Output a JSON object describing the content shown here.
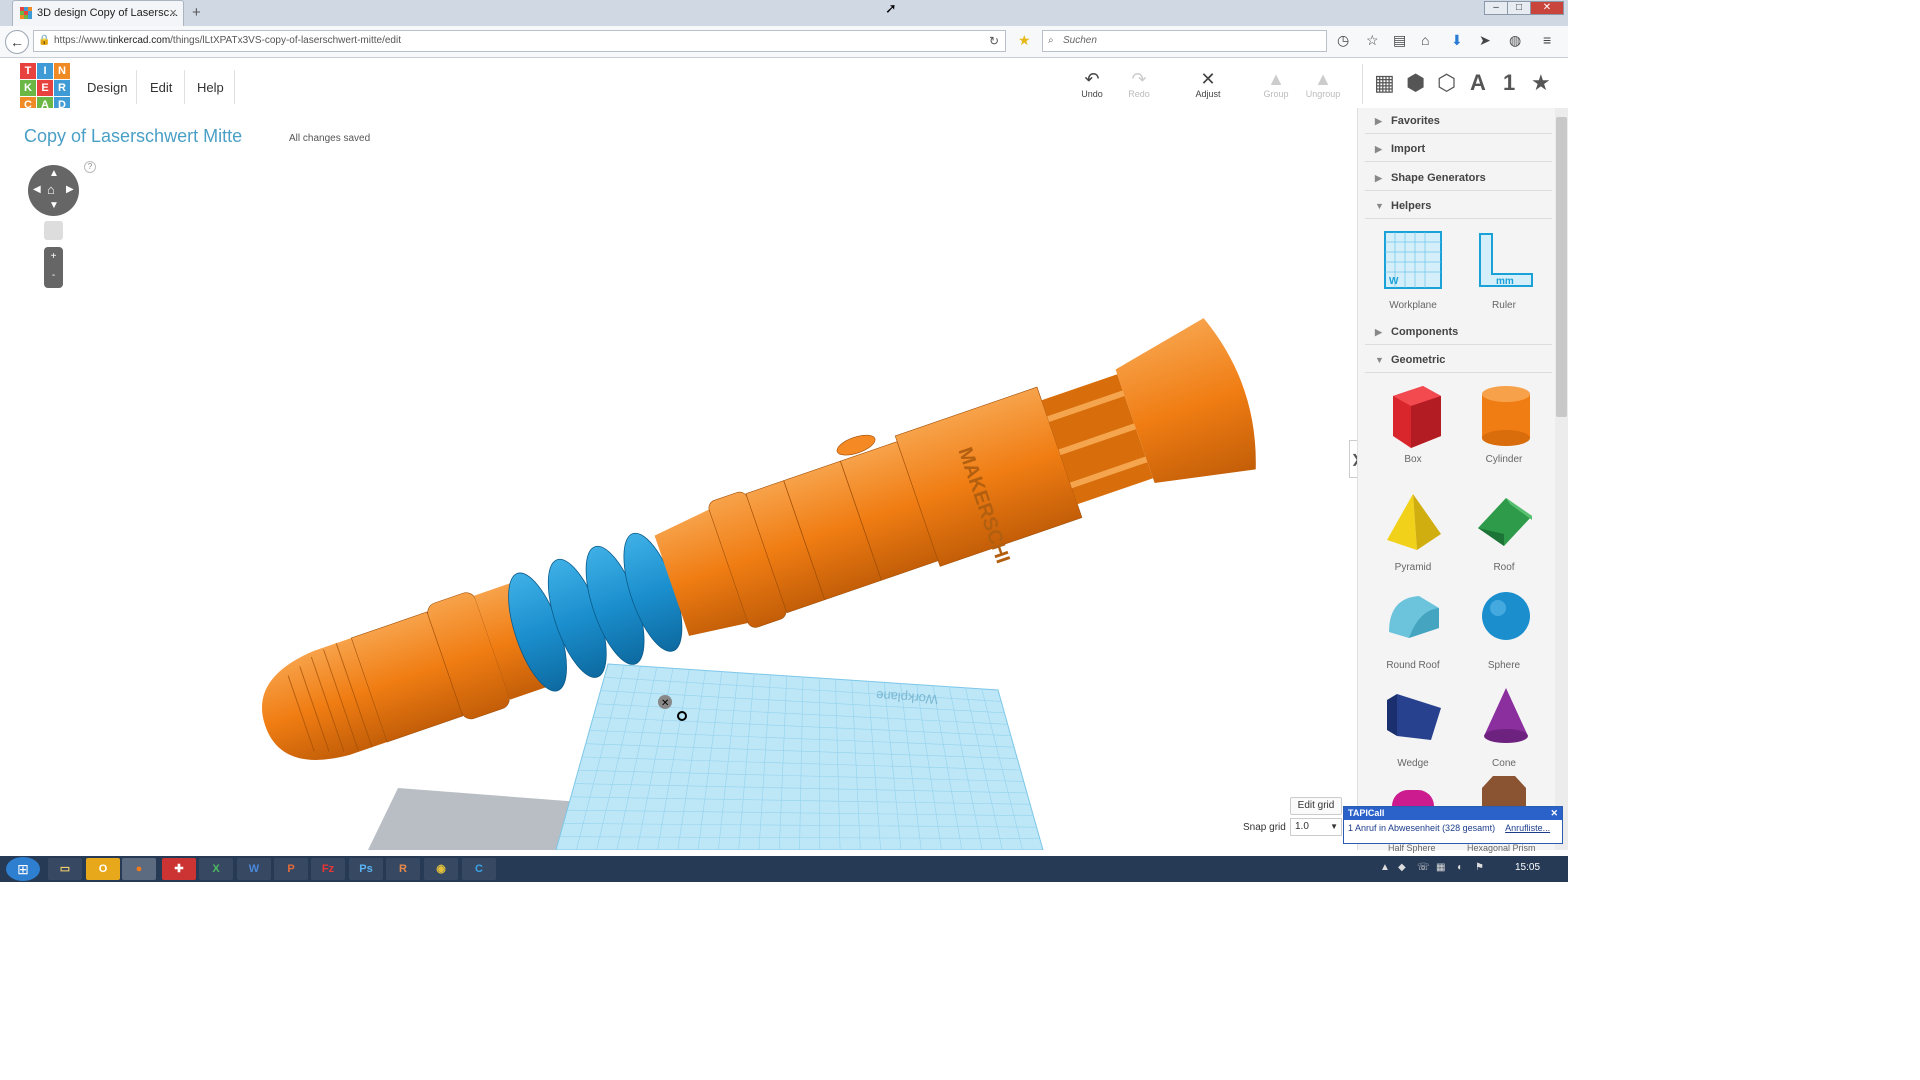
{
  "browser": {
    "tab_title": "3D design Copy of Lasersc...",
    "tab_close": "×",
    "new_tab": "+",
    "url_prefix": "https://www.",
    "url_domain": "tinkercad.com",
    "url_path": "/things/lLtXPATx3VS-copy-of-laserschwert-mitte/edit",
    "search_placeholder": "Suchen",
    "win_min": "–",
    "win_max": "□",
    "win_close": "✕"
  },
  "app": {
    "logo_letters": [
      "T",
      "I",
      "N",
      "K",
      "E",
      "R",
      "C",
      "A",
      "D"
    ],
    "logo_colors": [
      "#e8423f",
      "#3e9bd5",
      "#f08a24",
      "#6ab745",
      "#e8423f",
      "#3e9bd5",
      "#f08a24",
      "#6ab745",
      "#3e9bd5"
    ],
    "menu": [
      "Design",
      "Edit",
      "Help"
    ],
    "toolbar": {
      "undo": "Undo",
      "redo": "Redo",
      "adjust": "Adjust",
      "group": "Group",
      "ungroup": "Ungroup"
    },
    "view_letter": "A",
    "view_number": "1"
  },
  "design": {
    "title": "Copy of Laserschwert Mitte",
    "status": "All changes saved",
    "help": "?",
    "zoom_in": "+",
    "zoom_out": "-",
    "engraving": "MAKERSCHI",
    "workplane_label": "Workplane",
    "ruler_unit": "mm",
    "edit_grid": "Edit grid",
    "snap_label": "Snap grid",
    "snap_value": "1.0"
  },
  "sidebar": {
    "sections": {
      "favorites": "Favorites",
      "import": "Import",
      "shape_generators": "Shape Generators",
      "helpers": "Helpers",
      "components": "Components",
      "geometric": "Geometric"
    },
    "helpers": [
      "Workplane",
      "Ruler"
    ],
    "shapes": [
      "Box",
      "Cylinder",
      "Pyramid",
      "Roof",
      "Round Roof",
      "Sphere",
      "Wedge",
      "Cone",
      "Half Sphere",
      "Hexagonal Prism"
    ]
  },
  "notification": {
    "title": "TAPICall",
    "message": "1 Anruf in Abwesenheit (328 gesamt)",
    "link": "Anrufliste..."
  },
  "taskbar": {
    "apps": [
      "X",
      "W",
      "P",
      "Fz",
      "Ps",
      "R"
    ],
    "clock": "15:05"
  },
  "colors": {
    "orange": "#f07d13",
    "blue": "#1b8fce",
    "workplane": "#b8e3f5",
    "accent": "#4a9fc6"
  }
}
